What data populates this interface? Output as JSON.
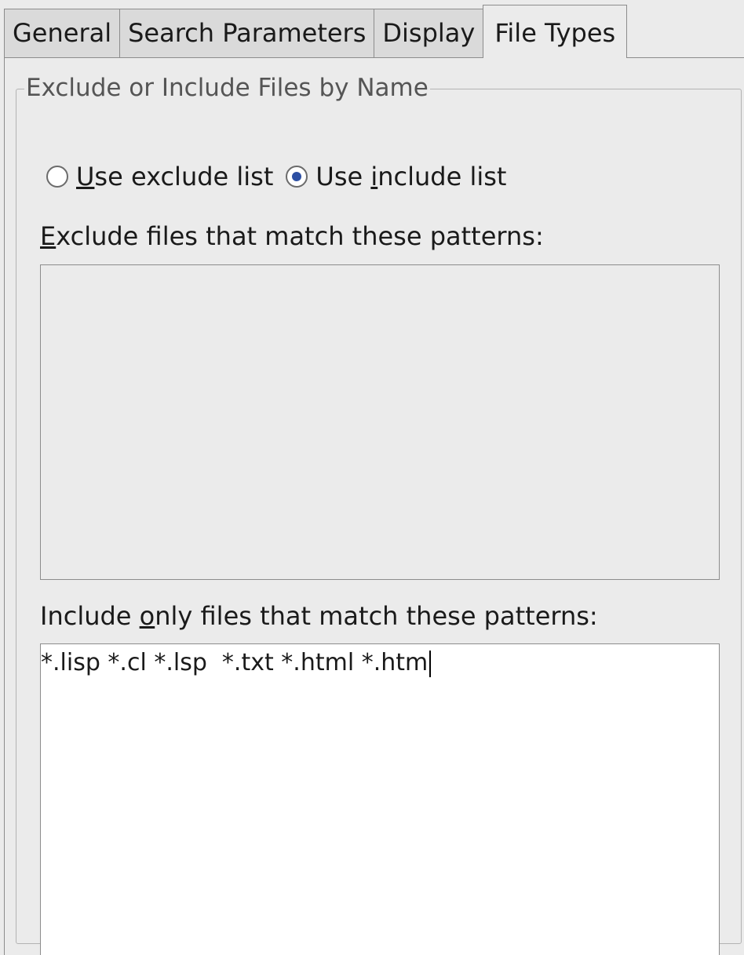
{
  "tabs": [
    {
      "label": "General",
      "active": false
    },
    {
      "label": "Search Parameters",
      "active": false
    },
    {
      "label": "Display",
      "active": false
    },
    {
      "label": "File Types",
      "active": true
    }
  ],
  "group": {
    "title": "Exclude or Include Files by Name"
  },
  "radios": {
    "exclude": {
      "prefix": "",
      "mnemonic": "U",
      "suffix": "se exclude list",
      "checked": false
    },
    "include": {
      "prefix": "Use ",
      "mnemonic": "i",
      "suffix": "nclude list",
      "checked": true
    }
  },
  "exclude_field": {
    "label_mnemonic": "E",
    "label_rest": "xclude files that match these patterns:",
    "value": "",
    "enabled": false
  },
  "include_field": {
    "label_prefix": "Include ",
    "label_mnemonic": "o",
    "label_rest": "nly files that match these patterns:",
    "value": "*.lisp *.cl *.lsp  *.txt *.html *.htm",
    "enabled": true
  },
  "colors": {
    "background": "#ebebeb",
    "tab_inactive": "#dadada",
    "radio_dot": "#2c4fa3",
    "border": "#8c8c8c"
  }
}
